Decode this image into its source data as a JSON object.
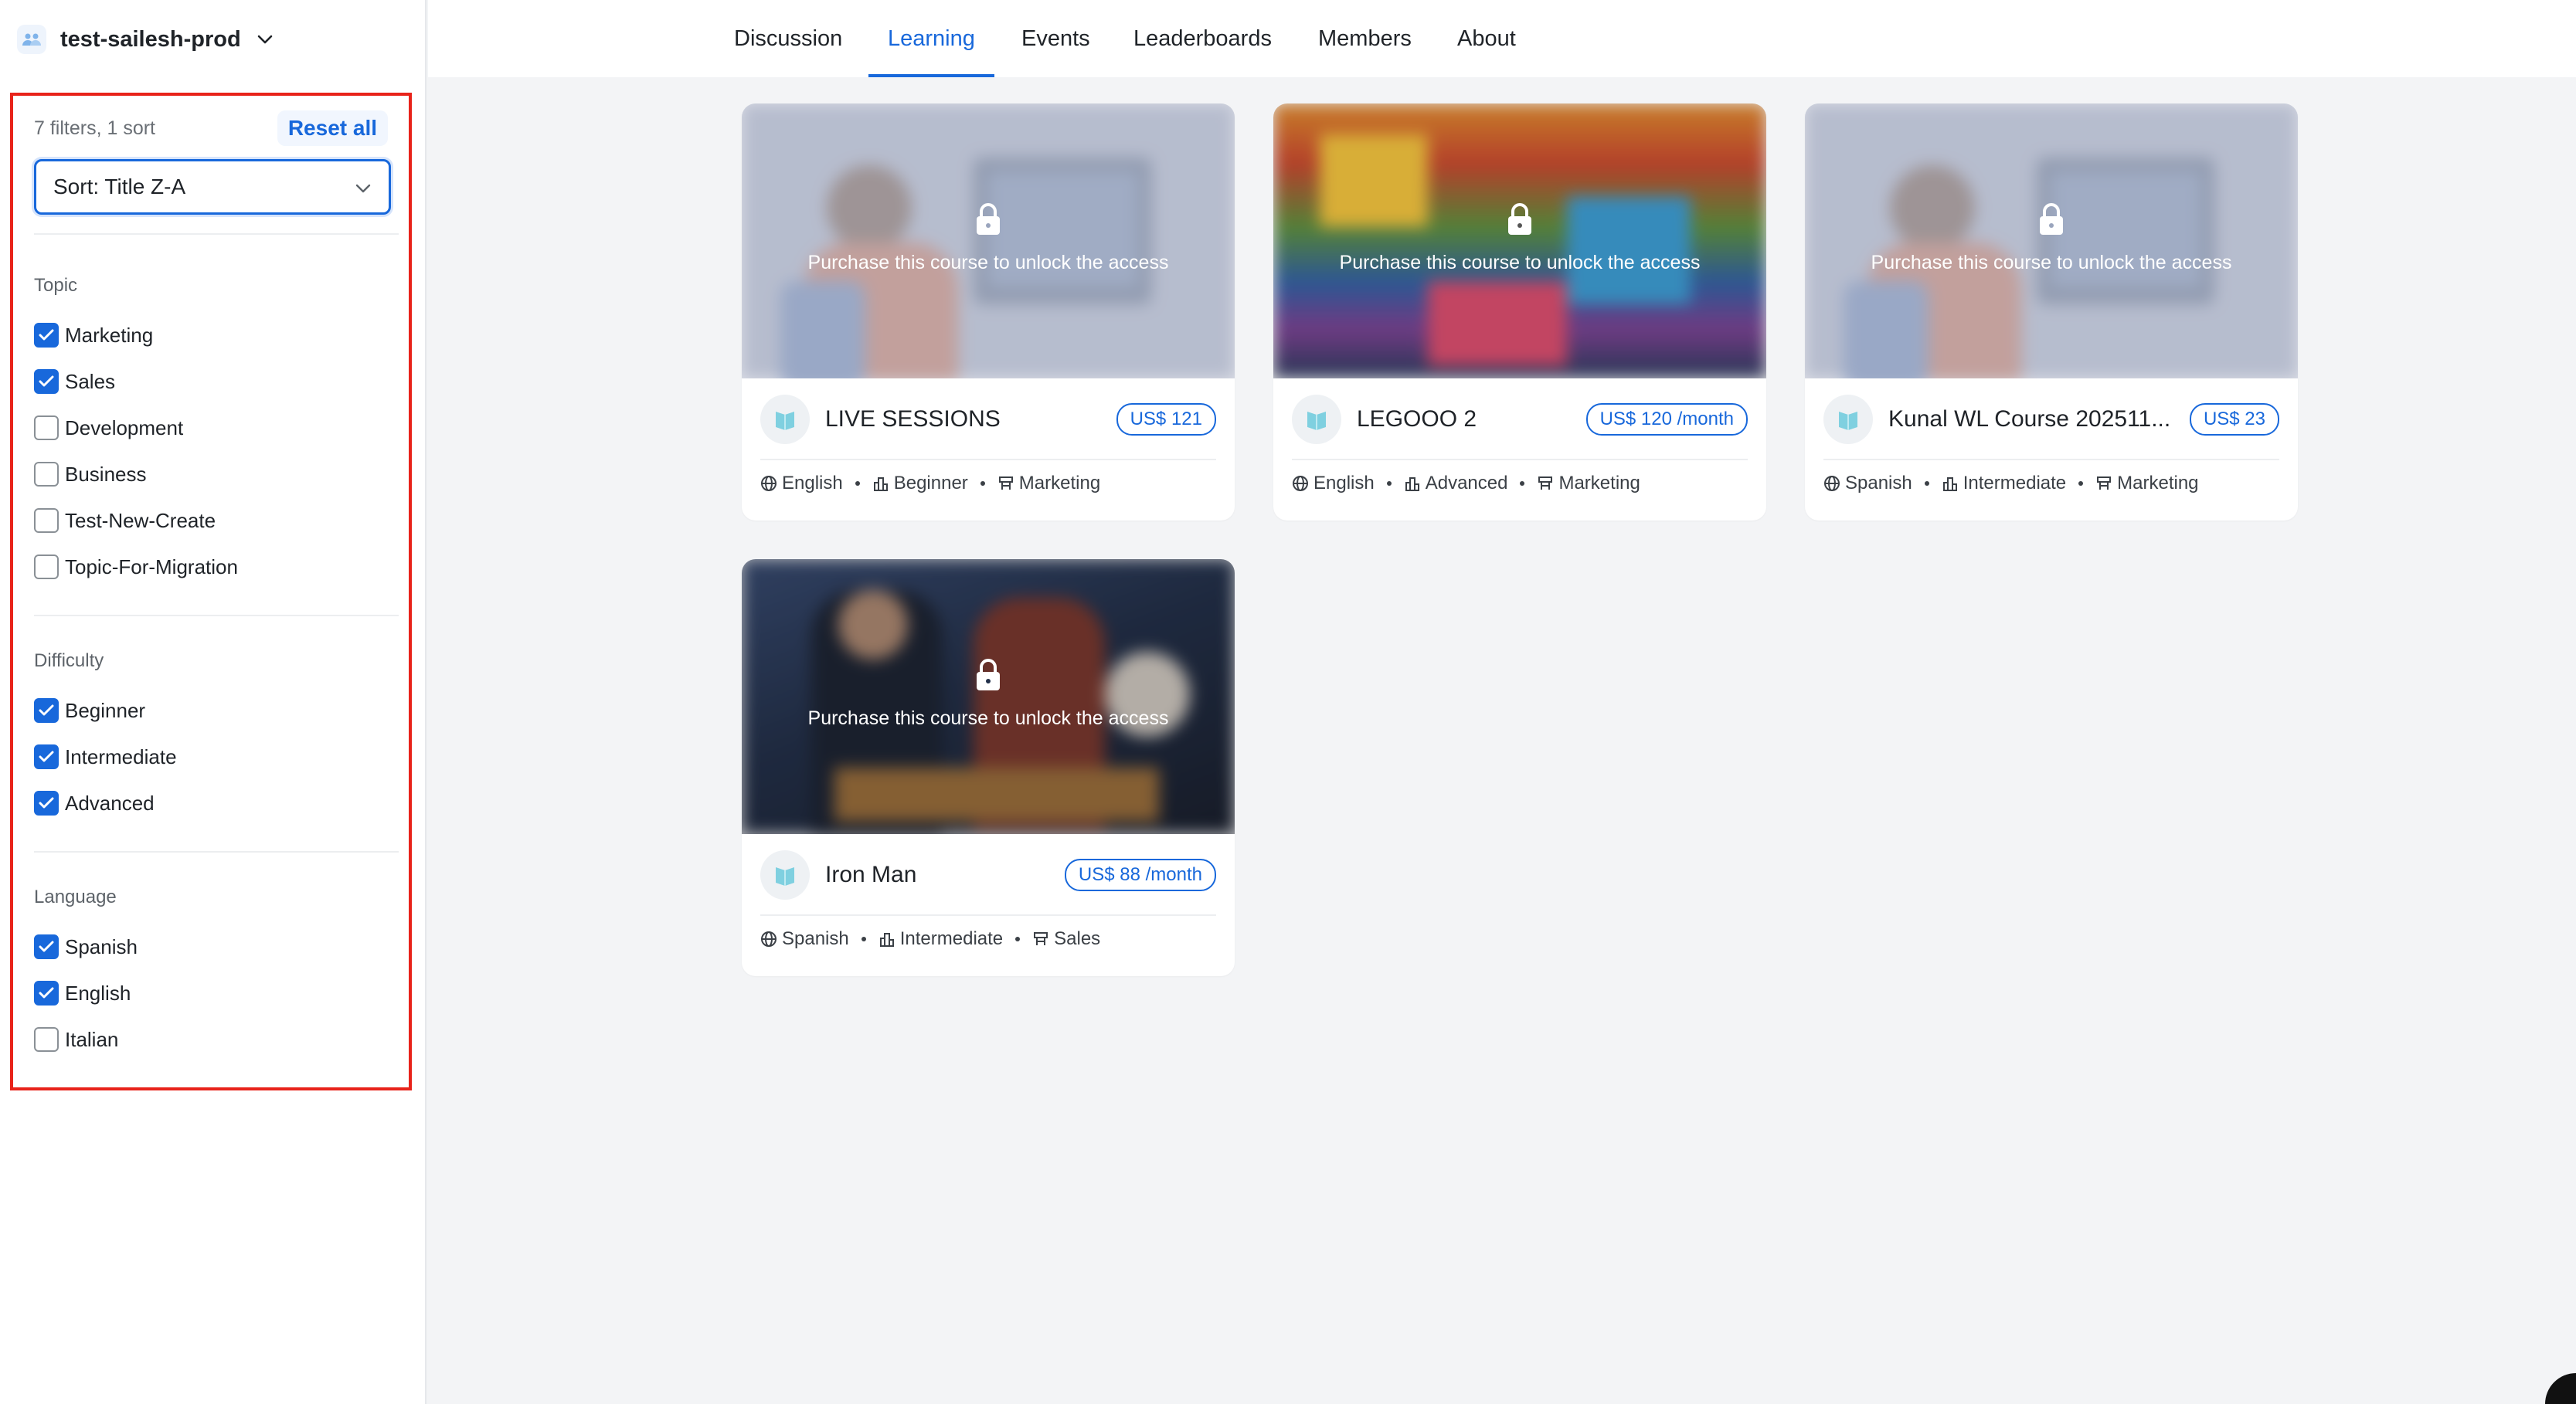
{
  "community": {
    "name": "test-sailesh-prod"
  },
  "nav": {
    "tabs": [
      {
        "label": "Discussion"
      },
      {
        "label": "Learning"
      },
      {
        "label": "Events"
      },
      {
        "label": "Leaderboards"
      },
      {
        "label": "Members"
      },
      {
        "label": "About"
      }
    ],
    "active": "Learning"
  },
  "filters": {
    "summary": "7 filters, 1 sort",
    "reset_label": "Reset all",
    "sort_label": "Sort: Title Z-A",
    "groups": [
      {
        "title": "Topic",
        "options": [
          {
            "label": "Marketing",
            "checked": true
          },
          {
            "label": "Sales",
            "checked": true
          },
          {
            "label": "Development",
            "checked": false
          },
          {
            "label": "Business",
            "checked": false
          },
          {
            "label": "Test-New-Create",
            "checked": false
          },
          {
            "label": "Topic-For-Migration",
            "checked": false
          }
        ]
      },
      {
        "title": "Difficulty",
        "options": [
          {
            "label": "Beginner",
            "checked": true
          },
          {
            "label": "Intermediate",
            "checked": true
          },
          {
            "label": "Advanced",
            "checked": true
          }
        ]
      },
      {
        "title": "Language",
        "options": [
          {
            "label": "Spanish",
            "checked": true
          },
          {
            "label": "English",
            "checked": true
          },
          {
            "label": "Italian",
            "checked": false
          }
        ]
      }
    ]
  },
  "courses": [
    {
      "title": "LIVE SESSIONS",
      "price": "US$ 121",
      "lock_text": "Purchase this course to unlock the access",
      "language": "English",
      "difficulty": "Beginner",
      "topic": "Marketing"
    },
    {
      "title": "LEGOOO 2",
      "price": "US$ 120 /month",
      "lock_text": "Purchase this course to unlock the access",
      "language": "English",
      "difficulty": "Advanced",
      "topic": "Marketing"
    },
    {
      "title": "Kunal WL Course 202511...",
      "price": "US$ 23",
      "lock_text": "Purchase this course to unlock the access",
      "language": "Spanish",
      "difficulty": "Intermediate",
      "topic": "Marketing"
    },
    {
      "title": "Iron Man",
      "price": "US$ 88 /month",
      "lock_text": "Purchase this course to unlock the access",
      "language": "Spanish",
      "difficulty": "Intermediate",
      "topic": "Sales"
    }
  ],
  "colors": {
    "accent": "#1868db",
    "highlight_border": "#e8231a",
    "page_bg": "#f3f4f6"
  }
}
